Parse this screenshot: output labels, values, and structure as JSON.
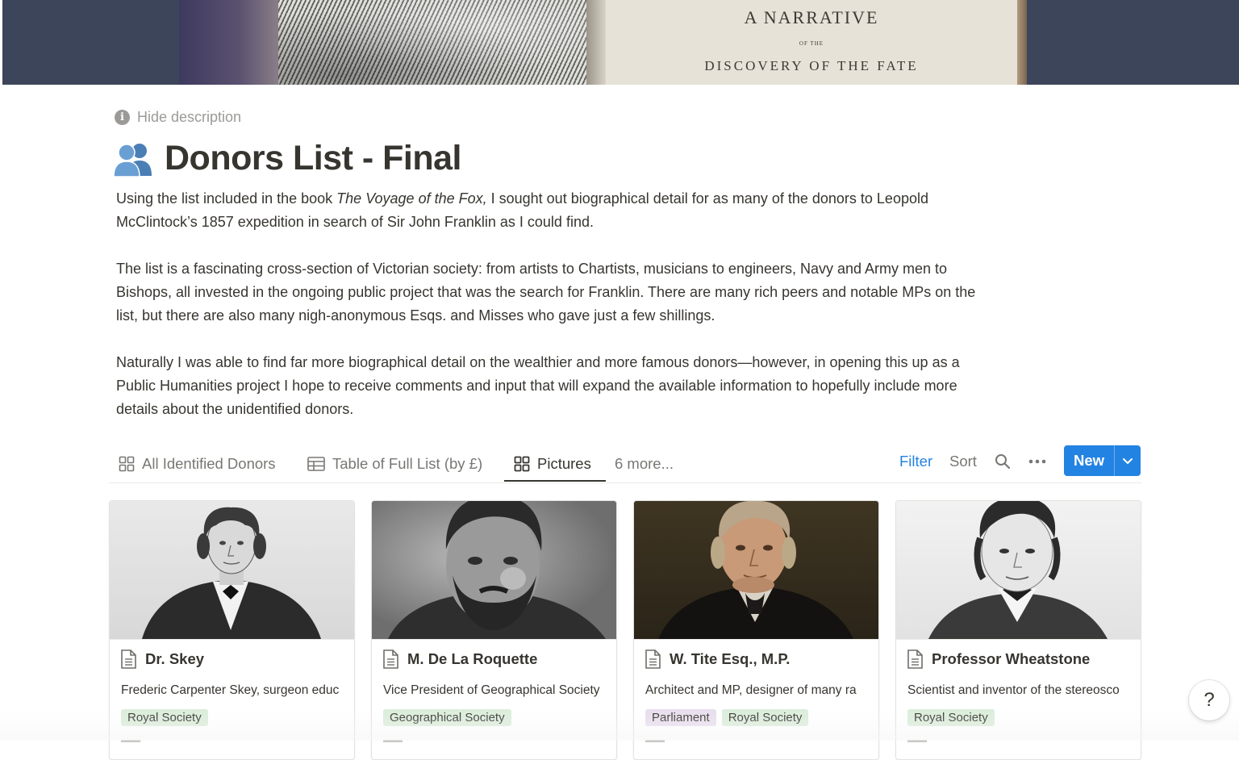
{
  "cover": {
    "line1": "A NARRATIVE",
    "line2": "OF THE",
    "line3": "DISCOVERY OF THE FATE"
  },
  "header": {
    "hide_description": "Hide description",
    "icon": "people-icon",
    "title": "Donors List - Final"
  },
  "description": {
    "p1_before": "Using the list included in the book ",
    "p1_italic": "The Voyage of the Fox,",
    "p1_after": " I sought out biographical detail for as many of the donors to Leopold McClintock’s 1857 expedition in search of Sir John Franklin as I could find.",
    "p2": "The list is a fascinating cross-section of Victorian society: from artists to Chartists, musicians to engineers, Navy and Army men to Bishops, all invested in the ongoing public project that was the search for Franklin. There are many rich peers and notable MPs on the list, but there are also many nigh-anonymous Esqs. and Misses who gave just a few shillings.",
    "p3": "Naturally I was able to find far more biographical detail on the wealthier and more famous donors—however, in opening this up as a Public Humanities project I hope to receive comments and input that will expand the available information to hopefully include more details about the unidentified donors."
  },
  "views": {
    "tabs": [
      {
        "label": "All Identified Donors",
        "icon": "gallery-icon"
      },
      {
        "label": "Table of Full List (by £)",
        "icon": "table-icon"
      },
      {
        "label": "Pictures",
        "icon": "gallery-icon",
        "active": true
      }
    ],
    "more": "6 more...",
    "filter": "Filter",
    "sort": "Sort",
    "new": "New"
  },
  "cards": [
    {
      "name": "Dr. Skey",
      "blurb": "Frederic Carpenter Skey, surgeon educ",
      "tags": [
        {
          "label": "Royal Society",
          "color": "green"
        }
      ]
    },
    {
      "name": "M. De La Roquette",
      "blurb": "Vice President of Geographical Society",
      "tags": [
        {
          "label": "Geographical Society",
          "color": "green"
        }
      ]
    },
    {
      "name": "W. Tite Esq., M.P.",
      "blurb": "Architect and MP, designer of many ra",
      "tags": [
        {
          "label": "Parliament",
          "color": "purple"
        },
        {
          "label": "Royal Society",
          "color": "green"
        }
      ]
    },
    {
      "name": "Professor Wheatstone",
      "blurb": "Scientist and inventor of the stereosco",
      "tags": [
        {
          "label": "Royal Society",
          "color": "green"
        }
      ]
    }
  ],
  "help": "?",
  "colors": {
    "accent": "#2383e2",
    "text": "#37352f",
    "muted": "#787774",
    "tag_green": "#dbeddb",
    "tag_purple": "#e8deee"
  }
}
